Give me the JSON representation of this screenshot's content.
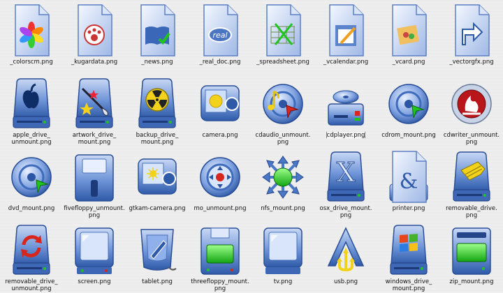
{
  "icons": [
    {
      "file": "_colorscm.png",
      "kind": "doc-colorscm",
      "icon": "color-pinwheel-icon"
    },
    {
      "file": "_kugardata.png",
      "kind": "doc-paw",
      "icon": "paw-print-icon"
    },
    {
      "file": "_news.png",
      "kind": "doc-book",
      "icon": "book-check-icon"
    },
    {
      "file": "_real_doc.png",
      "kind": "doc-real",
      "icon": "real-media-icon"
    },
    {
      "file": "_spreadsheet.png",
      "kind": "doc-spreadsheet",
      "icon": "spreadsheet-icon"
    },
    {
      "file": "_vcalendar.png",
      "kind": "doc-calendar",
      "icon": "calendar-pencil-icon"
    },
    {
      "file": "_vcard.png",
      "kind": "doc-vcard",
      "icon": "contact-card-icon"
    },
    {
      "file": "_vectorgfx.png",
      "kind": "doc-vector",
      "icon": "vector-arrow-icon"
    },
    {
      "file": "apple_drive_\nunmount.png",
      "kind": "drive-apple",
      "icon": "apple-drive-icon"
    },
    {
      "file": "artwork_drive_\nmount.png",
      "kind": "drive-artwork",
      "icon": "artwork-drive-icon"
    },
    {
      "file": "backup_drive_\nmount.png",
      "kind": "drive-backup",
      "icon": "radiation-drive-icon"
    },
    {
      "file": "camera.png",
      "kind": "camera",
      "icon": "camera-icon"
    },
    {
      "file": "cdaudio_unmount.\npng",
      "kind": "cdaudio",
      "icon": "audio-cd-icon"
    },
    {
      "file": "cdplayer.png",
      "kind": "cdplayer",
      "icon": "cd-player-icon",
      "selected": true
    },
    {
      "file": "cdrom_mount.png",
      "kind": "cdrom",
      "icon": "cdrom-icon"
    },
    {
      "file": "cdwriter_unmount.\npng",
      "kind": "cdwriter",
      "icon": "cd-writer-flame-icon"
    },
    {
      "file": "dvd_mount.png",
      "kind": "dvd",
      "icon": "dvd-icon"
    },
    {
      "file": "fivefloppy_unmount.\npng",
      "kind": "floppy5",
      "icon": "floppy-disk-icon"
    },
    {
      "file": "gtkam-camera.png",
      "kind": "gtkam",
      "icon": "digital-camera-icon"
    },
    {
      "file": "mo_unmount.png",
      "kind": "mo",
      "icon": "magneto-optical-icon"
    },
    {
      "file": "nfs_mount.png",
      "kind": "nfs",
      "icon": "network-share-icon"
    },
    {
      "file": "osx_drive_mount.\npng",
      "kind": "osx",
      "icon": "osx-x-icon"
    },
    {
      "file": "printer.png",
      "kind": "printer",
      "icon": "printer-ampersand-icon"
    },
    {
      "file": "removable_drive.\npng",
      "kind": "removable",
      "icon": "removable-drive-hand-icon"
    },
    {
      "file": "removable_drive_\nunmount.png",
      "kind": "removable-unmount",
      "icon": "refresh-drive-icon"
    },
    {
      "file": "screen.png",
      "kind": "screen",
      "icon": "monitor-screen-icon"
    },
    {
      "file": "tablet.png",
      "kind": "tablet",
      "icon": "graphics-tablet-icon"
    },
    {
      "file": "threefloppy_mount.\npng",
      "kind": "floppy3",
      "icon": "floppy-3-icon"
    },
    {
      "file": "tv.png",
      "kind": "tv",
      "icon": "tv-icon"
    },
    {
      "file": "usb.png",
      "kind": "usb",
      "icon": "usb-icon"
    },
    {
      "file": "windows_drive_\nmount.png",
      "kind": "windows",
      "icon": "windows-drive-icon"
    },
    {
      "file": "zip_mount.png",
      "kind": "zip",
      "icon": "zip-drive-icon"
    }
  ],
  "colors": {
    "blue_dark": "#2f5aa8",
    "blue_mid": "#6f95d8",
    "blue_light": "#c9d8f4",
    "green": "#21c41e",
    "red": "#d8261c",
    "yellow": "#f2d21b"
  }
}
